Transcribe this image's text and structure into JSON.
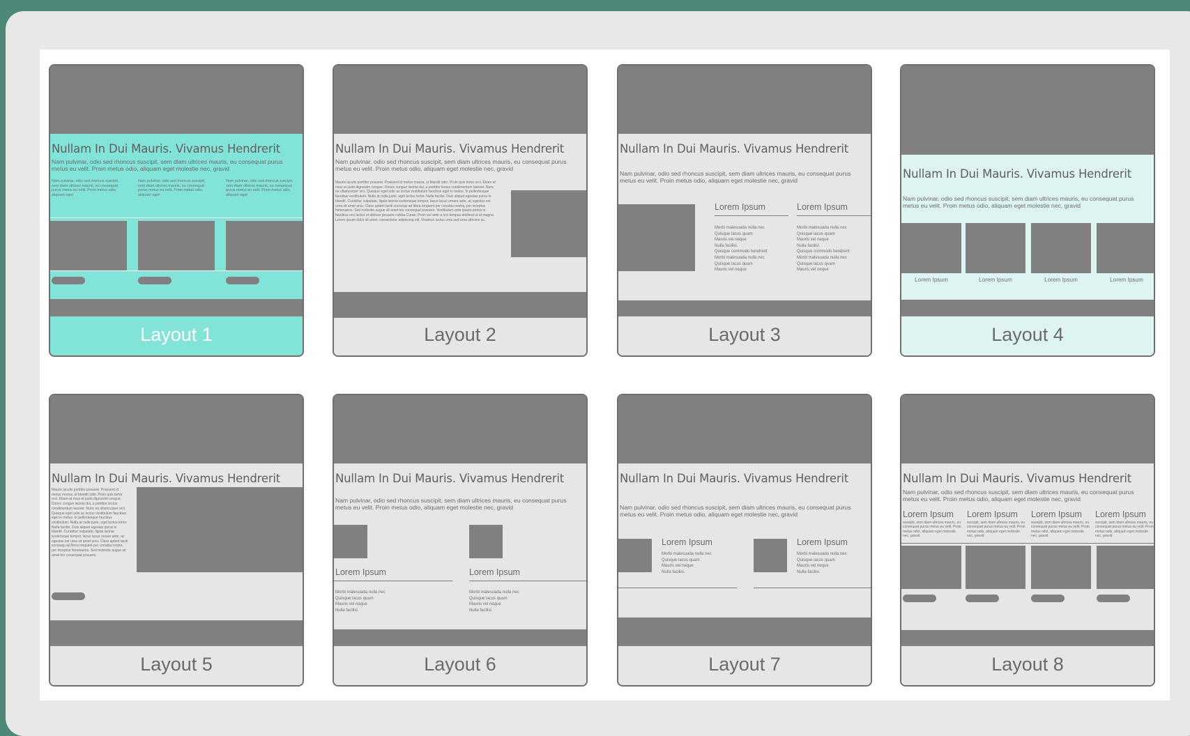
{
  "layouts": [
    {
      "label": "Layout 1"
    },
    {
      "label": "Layout 2"
    },
    {
      "label": "Layout 3"
    },
    {
      "label": "Layout 4"
    },
    {
      "label": "Layout 5"
    },
    {
      "label": "Layout 6"
    },
    {
      "label": "Layout 7"
    },
    {
      "label": "Layout 8"
    }
  ],
  "selected": "Layout 1",
  "preview": {
    "title": "Nullam In Dui Mauris. Vivamus Hendrerit",
    "sub1": "Nam pulvinar, odio sed rhoncus suscipit, sem diam ultrices mauris, eu consequat purus",
    "sub2": "metus eu velit. Proin metus odio, aliquam eget molestie nec, gravid",
    "col_text": "Nam pulvinar, odio sed rhoncus suscipit, sem diam ultrices mauris, eu consequat purus metus eu velit. Proin metus odio, aliquam eget",
    "body_text": "Mauris iaculis porttitor posuere. Praesent id metus massa, ut blandit odio. Proin quis tortor orci. Etiam at risus et justo dignissim congue. Donec congue lacinia dui, a porttitor lectus condimentum laoreet. Nunc eu ullamcorper orci. Quisque eget odio ac lectus vestibulum faucibus eget in metus. In pellentesque faucibus vestibulum. Nulla at nulla justo, eget luctus tortor. Nulla facilisi. Duis aliquet egestas purus in blandit. Curabitur vulputate, ligula lacinia scelerisque tempor, lacus lacus ornare ante, ac egestas est urna sit amet arcu. Class aptent taciti sociosqu ad litora torquent per conubia nostra, per inceptos himenaeos. Sed molestie augue sit amet leo consequat posuere. Vestibulum ante ipsum primis in faucibus orci luctus et ultrices posuere cubilia Curae; Proin vel ante a orci tempus eleifend ut et magna. Lorem ipsum dolor sit amet, consectetur adipiscing elit. Vivamus luctus urna sed urna ultricies ac.",
    "body_text_short": "Mauris iaculis porttitor posuere. Praesent id metus massa, ut blandit odio. Proin quis tortor orci. Etiam at risus et justo dignissim congue. Donec congue lacinia dui, a porttitor lectus condimentum laoreet. Nunc eu ullamcorper orci. Quisque eget odio ac lectus vestibulum faucibus eget in metus. In pellentesque faucibus vestibulum. Nulla at nulla justo, eget luctus tortor. Nulla facilisi. Duis aliquet egestas purus in blandit. Curabitur vulputate, ligula lacinia scelerisque tempor, lacus lacus ornare ante, ac egestas est urna sit amet arcu. Class aptent taciti sociosqu ad litora torquent per conubia nostra, per inceptos himenaeos. Sed molestie augue sit amet leo consequat posuere.",
    "lorem": "Lorem Ipsum",
    "list4": "Morbi malesuada nulla nec\nQuisque lacus quam\nMauris vel neque\nNulla facilisi.",
    "list8": "Morbi malesuada nulla nec\nQuisque lacus quam\nMauris vel neque\nNulla facilisi.\nQuisque commodo hendrerit\nMorbi malesuada nulla nec\nQuisque lacus quam\nMauris vel neque",
    "col8_text": "suscipit, sem diam ultrices mauris, eu consequat purus metus eu velit. Proin metus odio, aliquam eget molestie nec, gravid"
  },
  "colors": {
    "accent": "#82e3d8",
    "accent_light": "#def4f3",
    "frame": "#808080",
    "background": "#4d8878"
  }
}
